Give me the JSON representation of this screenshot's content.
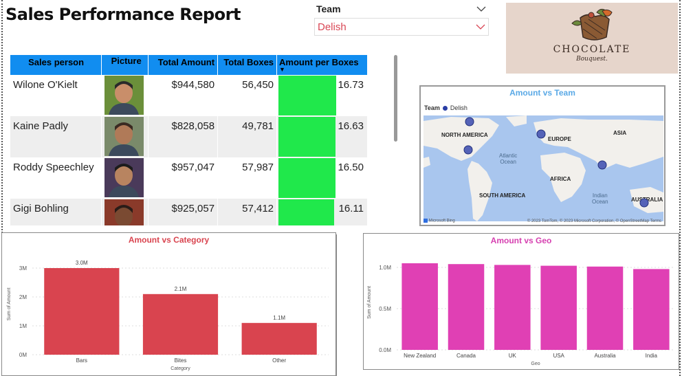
{
  "report": {
    "title": "Sales Performance Report"
  },
  "slicer": {
    "label": "Team",
    "value": "Delish"
  },
  "logo": {
    "brand": "CHOCOLATE",
    "tagline": "Bouquest."
  },
  "table": {
    "columns": [
      "Sales person",
      "Picture",
      "Total Amount",
      "Total Boxes",
      "Amount per Boxes"
    ],
    "rows": [
      {
        "name": "Wilone O'Kielt",
        "amount": "$944,580",
        "boxes": "56,450",
        "apb": "16.73",
        "apb_value": 16.73
      },
      {
        "name": "Kaine Padly",
        "amount": "$828,058",
        "boxes": "49,781",
        "apb": "16.63",
        "apb_value": 16.63
      },
      {
        "name": "Roddy Speechley",
        "amount": "$957,047",
        "boxes": "57,987",
        "apb": "16.50",
        "apb_value": 16.5
      },
      {
        "name": "Gigi Bohling",
        "amount": "$925,057",
        "boxes": "57,412",
        "apb": "16.11",
        "apb_value": 16.11
      }
    ],
    "bar_color": "#20e84b",
    "header_color": "#118df0"
  },
  "map": {
    "title": "Amount vs Team",
    "legend_title": "Team",
    "legend_item": "Delish",
    "labels": {
      "na": "NORTH AMERICA",
      "eu": "EUROPE",
      "asia": "ASIA",
      "africa": "AFRICA",
      "sa": "SOUTH AMERICA",
      "aus": "AUSTRALIA"
    },
    "oceans": {
      "atlantic": "Atlantic\nOcean",
      "indian": "Indian\nOcean"
    },
    "attribution_left": "Microsoft Bing",
    "attribution_right": "© 2023 TomTom, © 2023 Microsoft Corporation, © OpenStreetMap  Terms",
    "dot_color": "#5563b8"
  },
  "chart_data": [
    {
      "type": "bar",
      "title": "Amount vs Category",
      "categories": [
        "Bars",
        "Bites",
        "Other"
      ],
      "values": [
        3000000,
        2100000,
        1100000
      ],
      "data_labels": [
        "3.0M",
        "2.1M",
        "1.1M"
      ],
      "xlabel": "Category",
      "ylabel": "Sum of Amount",
      "ylim": [
        0,
        3500000
      ],
      "yticks": [
        0,
        1000000,
        2000000,
        3000000
      ],
      "ytick_labels": [
        "0M",
        "1M",
        "2M",
        "3M"
      ],
      "color": "#d9444f"
    },
    {
      "type": "bar",
      "title": "Amount vs Geo",
      "categories": [
        "New Zealand",
        "Canada",
        "UK",
        "USA",
        "Australia",
        "India"
      ],
      "values": [
        1050000,
        1040000,
        1030000,
        1020000,
        1010000,
        980000
      ],
      "xlabel": "Geo",
      "ylabel": "Sum of Amount",
      "ylim": [
        0,
        1150000
      ],
      "yticks": [
        0,
        500000,
        1000000
      ],
      "ytick_labels": [
        "0.0M",
        "0.5M",
        "1.0M"
      ],
      "color": "#e040b4"
    }
  ]
}
